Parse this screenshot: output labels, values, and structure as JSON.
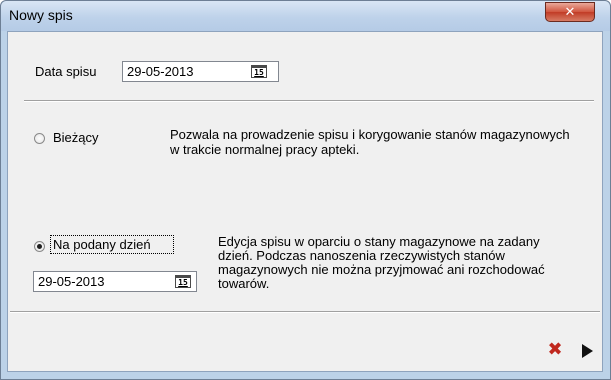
{
  "window": {
    "title": "Nowy spis",
    "close_glyph": "✕"
  },
  "date_section": {
    "label": "Data spisu",
    "value": "29-05-2013",
    "calendar_icon": "calendar-icon",
    "calendar_icon_text": "15"
  },
  "options": {
    "current": {
      "label": "Bieżący",
      "selected": false,
      "description_line1": "Pozwala na prowadzenie spisu i korygowanie stanów magazynowych",
      "description_line2": "w trakcie normalnej pracy apteki."
    },
    "given_day": {
      "label": "Na podany dzień",
      "selected": true,
      "date_value": "29-05-2013",
      "calendar_icon_text": "15",
      "description_lines": [
        "Edycja spisu w oparciu o stany magazynowe na zadany",
        "dzień. Podczas nanoszenia rzeczywistych stanów",
        "magazynowych nie można przyjmować ani rozchodować",
        "towarów."
      ]
    }
  },
  "actions": {
    "cancel_icon": "cancel-x-icon",
    "cancel_glyph": "✖",
    "confirm_icon": "play-arrow-icon"
  },
  "colors": {
    "cancel": "#c0281e",
    "title_bar": "#bed2ea",
    "close_button": "#c13c26"
  }
}
